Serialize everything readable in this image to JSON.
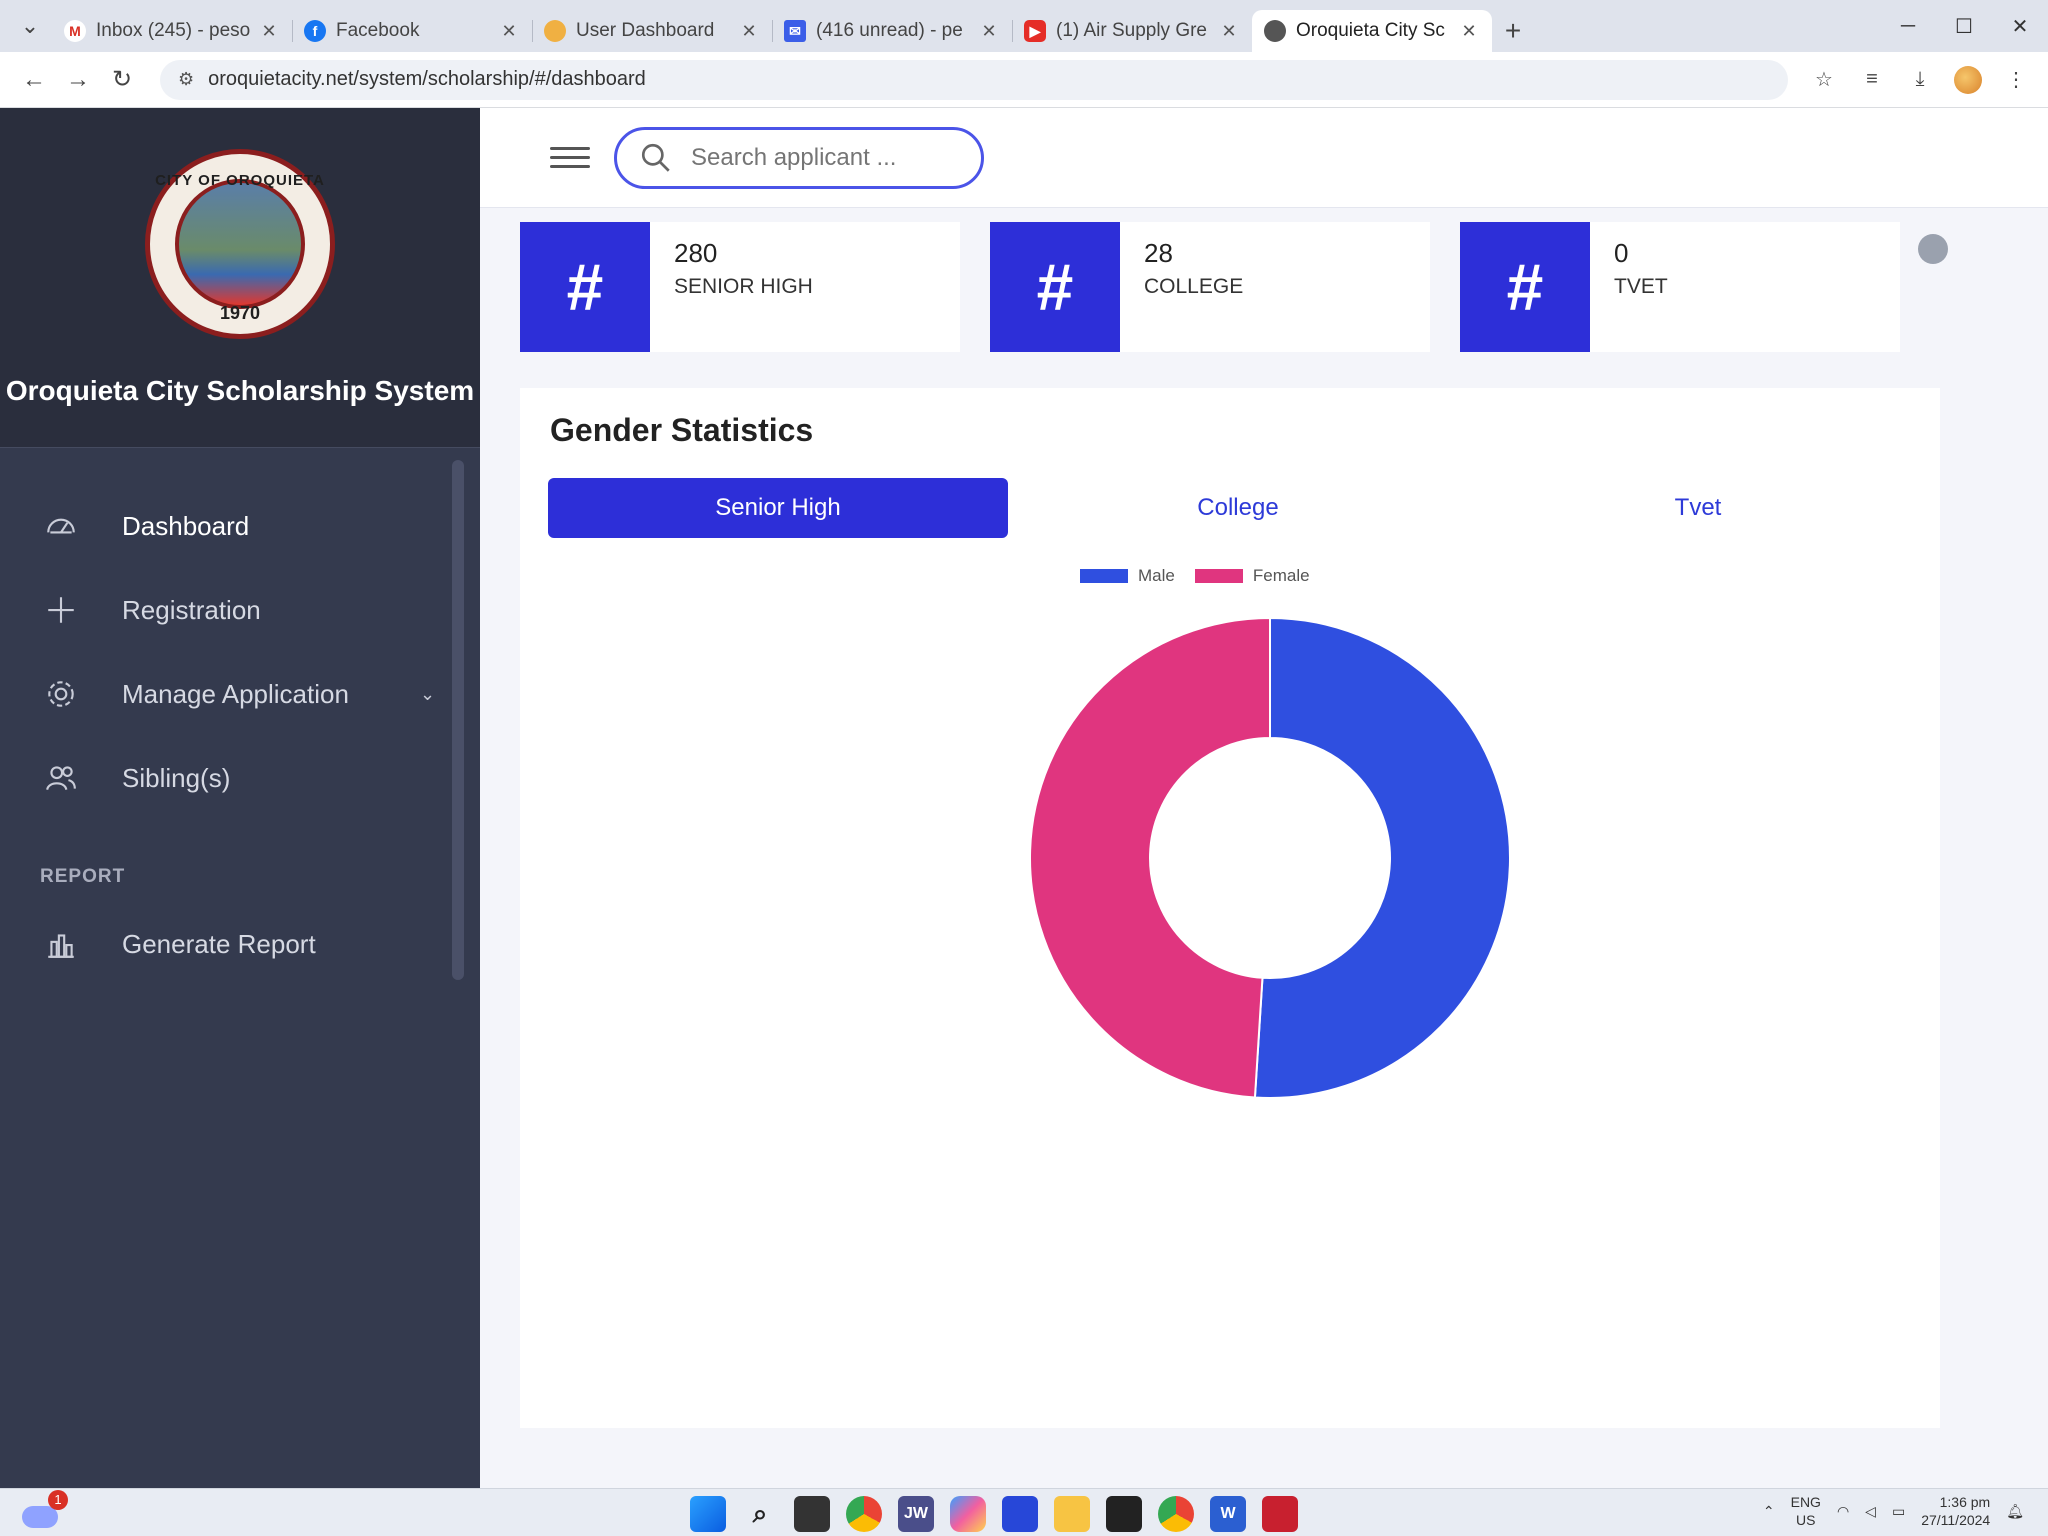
{
  "browser": {
    "tabs": [
      {
        "title": "Inbox (245) - peso",
        "icon": "gmail-icon",
        "color": "#d93025"
      },
      {
        "title": "Facebook",
        "icon": "facebook-icon",
        "color": "#1877f2"
      },
      {
        "title": "User Dashboard",
        "icon": "site-icon",
        "color": "#f0b042"
      },
      {
        "title": "(416 unread) - pe",
        "icon": "mail-icon",
        "color": "#3b5ee8"
      },
      {
        "title": "(1) Air Supply Gre",
        "icon": "youtube-icon",
        "color": "#e52d27"
      },
      {
        "title": "Oroquieta City Sc",
        "icon": "site-icon",
        "color": "#555555"
      }
    ],
    "url": "oroquietacity.net/system/scholarship/#/dashboard"
  },
  "sidebar": {
    "seal_top": "CITY OF OROQUIETA",
    "seal_year": "1970",
    "title": "Oroquieta City Scholarship System",
    "items": [
      {
        "label": "Dashboard"
      },
      {
        "label": "Registration"
      },
      {
        "label": "Manage Application"
      },
      {
        "label": "Sibling(s)"
      }
    ],
    "report_header": "REPORT",
    "report_item": "Generate Report"
  },
  "search": {
    "placeholder": "Search applicant ..."
  },
  "stats": [
    {
      "value": "280",
      "label": "SENIOR HIGH",
      "icon": "#"
    },
    {
      "value": "28",
      "label": "COLLEGE",
      "icon": "#"
    },
    {
      "value": "0",
      "label": "TVET",
      "icon": "#"
    }
  ],
  "chart": {
    "title": "Gender Statistics",
    "tabs": [
      "Senior High",
      "College",
      "Tvet"
    ],
    "active_tab": "Senior High"
  },
  "chart_data": {
    "type": "pie",
    "subtype": "doughnut",
    "categories": [
      "Male",
      "Female"
    ],
    "values": [
      51,
      49
    ],
    "colors": [
      "#2f4fe0",
      "#e0357f"
    ],
    "legend": "top"
  },
  "taskbar": {
    "notification_count": "1",
    "apps": [
      "windows-start-icon",
      "search-icon",
      "task-view-icon",
      "chrome-icon",
      "jw-icon",
      "copilot-icon",
      "app-icon",
      "file-explorer-icon",
      "sticky-notes-icon",
      "chrome-icon",
      "word-icon",
      "mcafee-icon"
    ],
    "jw_label": "JW",
    "word_label": "W",
    "lang_top": "ENG",
    "lang_bottom": "US",
    "time": "1:36 pm",
    "date": "27/11/2024"
  }
}
